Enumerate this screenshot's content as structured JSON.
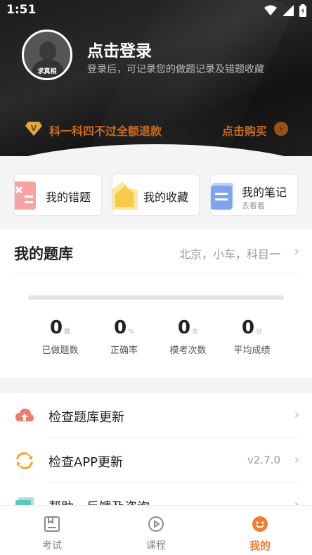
{
  "status_bar": {
    "time": "1:51"
  },
  "profile": {
    "avatar_tag": "求真相",
    "title": "点击登录",
    "subtitle": "登录后，可记录您的做题记录及错题收藏"
  },
  "promo": {
    "text": "科一科四不过全额退款",
    "action": "点击购买"
  },
  "quick_cards": [
    {
      "label": "我的错题",
      "sub": ""
    },
    {
      "label": "我的收藏",
      "sub": ""
    },
    {
      "label": "我的笔记",
      "sub": "去看看"
    }
  ],
  "question_bank": {
    "title": "我的题库",
    "region": "北京，小车，科目一",
    "progress": 0,
    "stats": [
      {
        "value": "0",
        "unit": "题",
        "label": "已做题数"
      },
      {
        "value": "0",
        "unit": "%",
        "label": "正确率"
      },
      {
        "value": "0",
        "unit": "次",
        "label": "模考次数"
      },
      {
        "value": "0",
        "unit": "分",
        "label": "平均成绩"
      }
    ]
  },
  "menu": [
    {
      "label": "检查题库更新",
      "value": "",
      "icon": "cloud-upload-icon"
    },
    {
      "label": "检查APP更新",
      "value": "v2.7.0",
      "icon": "refresh-icon"
    },
    {
      "label": "帮助、反馈及咨询",
      "value": "",
      "icon": "help-icon"
    }
  ],
  "bottom_nav": [
    {
      "label": "考试",
      "icon": "book-icon",
      "active": false
    },
    {
      "label": "课程",
      "icon": "play-icon",
      "active": false
    },
    {
      "label": "我的",
      "icon": "smile-icon",
      "active": true
    }
  ],
  "colors": {
    "accent": "#f07d2c",
    "promo": "#c66a1f",
    "header_bg": "#1e1e1e"
  }
}
